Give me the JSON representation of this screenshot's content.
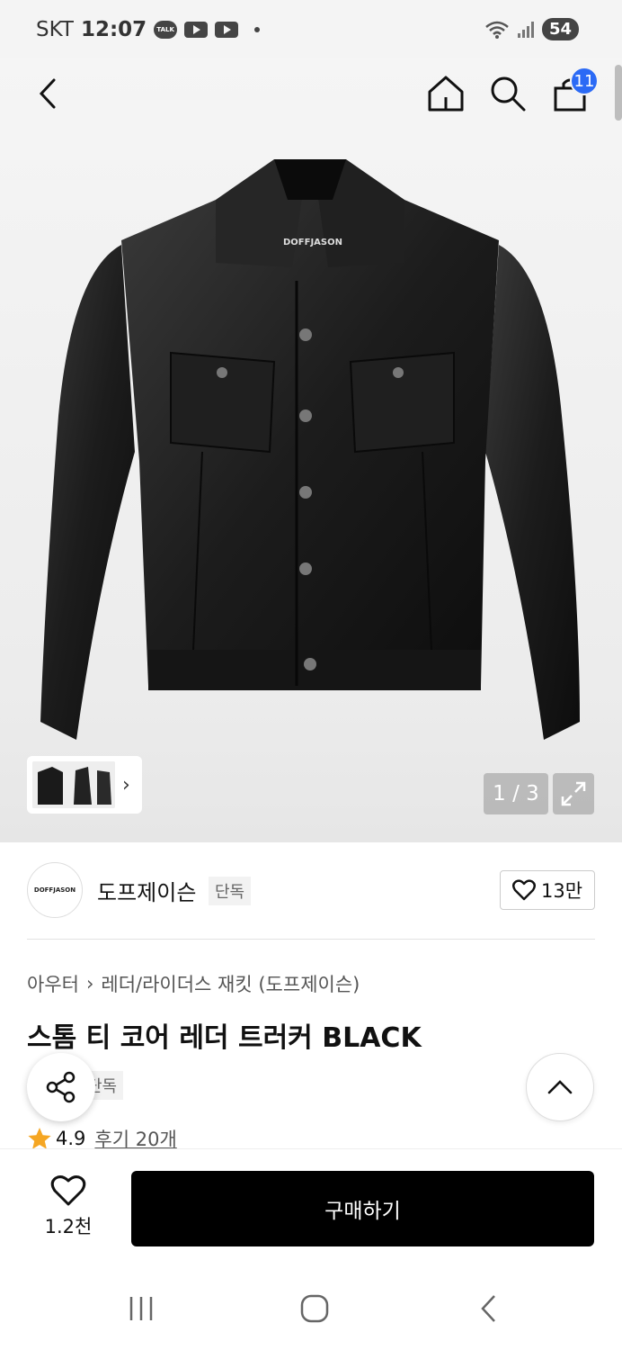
{
  "status_bar": {
    "carrier": "SKT",
    "time": "12:07",
    "kakao_label": "TALK",
    "battery": "54"
  },
  "header": {
    "cart_count": "11"
  },
  "gallery": {
    "jacket_label": "DOFFJASON",
    "page_counter": "1 / 3"
  },
  "brand": {
    "logo_text": "DOFFJASON",
    "name": "도프제이슨",
    "tag": "단독",
    "likes": "13만"
  },
  "product": {
    "breadcrumb": [
      "아우터",
      "레더/라이더스 재킷 (도프제이슨)"
    ],
    "title": "스톰 티 코어 레더 트러커 BLACK",
    "exclusive_tag": "단독",
    "rating": "4.9",
    "reviews": "후기 20개"
  },
  "bottom_bar": {
    "wish_count": "1.2천",
    "buy_label": "구매하기"
  },
  "colors": {
    "accent": "#2b6af5",
    "star": "#f5a623",
    "buy": "#000000"
  }
}
